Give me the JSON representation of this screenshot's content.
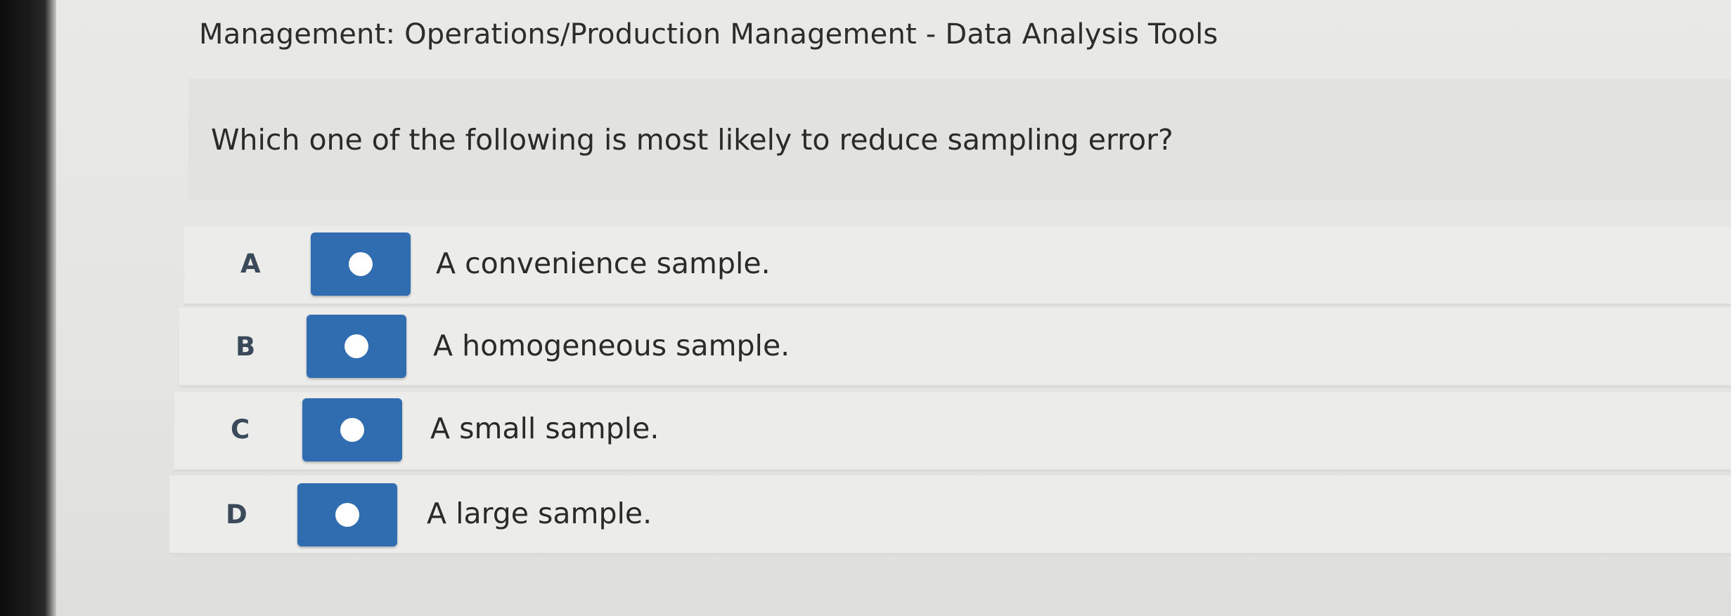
{
  "header": {
    "topic": "Management: Operations/Production Management - Data Analysis Tools"
  },
  "question": {
    "text": "Which one of the following is most likely to reduce sampling error?"
  },
  "options": [
    {
      "letter": "A",
      "text": "A convenience sample."
    },
    {
      "letter": "B",
      "text": "A homogeneous sample."
    },
    {
      "letter": "C",
      "text": "A small sample."
    },
    {
      "letter": "D",
      "text": "A large sample."
    }
  ],
  "colors": {
    "radio_button": "#2f6db0",
    "radio_dot": "#ffffff",
    "letter": "#3a4a5a",
    "text": "#2a2a2a"
  }
}
